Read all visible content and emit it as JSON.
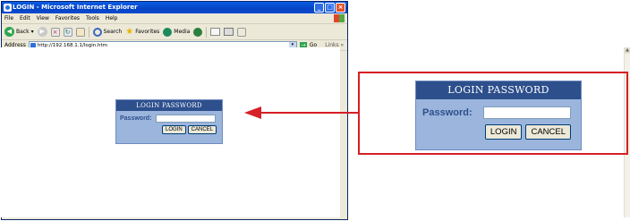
{
  "browser": {
    "title": "LOGIN - Microsoft Internet Explorer",
    "menu": [
      "File",
      "Edit",
      "View",
      "Favorites",
      "Tools",
      "Help"
    ],
    "toolbar": {
      "back_label": "Back",
      "search_label": "Search",
      "favorites_label": "Favorites",
      "media_label": "Media"
    },
    "address": {
      "label": "Address",
      "url": "http://192.168.1.1/login.htm",
      "go_label": "Go",
      "links_label": "Links »"
    }
  },
  "login_small": {
    "header": "LOGIN PASSWORD",
    "password_label": "Password:",
    "password_value": "",
    "login_button": "LOGIN",
    "cancel_button": "CANCEL"
  },
  "login_large": {
    "header": "LOGIN PASSWORD",
    "password_label": "Password:",
    "password_value": "",
    "login_button": "LOGIN",
    "cancel_button": "CANCEL"
  },
  "colors": {
    "callout": "#d61f26",
    "panel_header": "#2d4f8c",
    "panel_body": "#9bb5dd"
  }
}
